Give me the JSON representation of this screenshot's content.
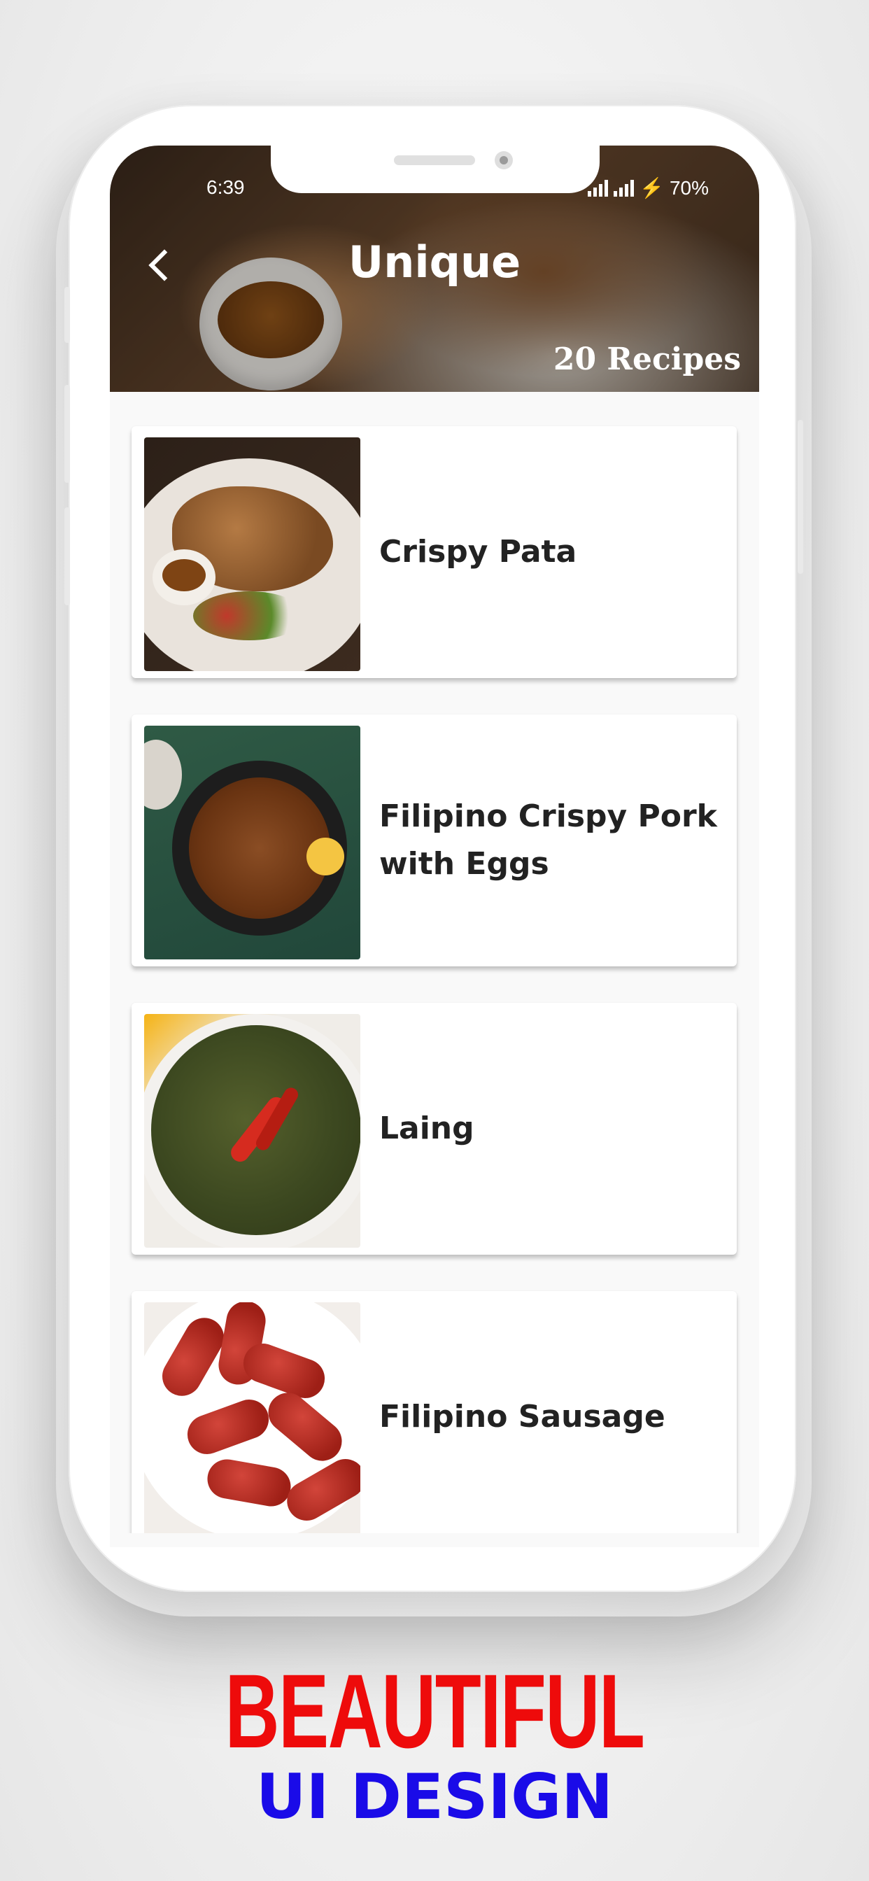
{
  "status_bar": {
    "time": "6:39",
    "battery": "70%"
  },
  "header": {
    "title": "Unique",
    "recipe_count": "20 Recipes"
  },
  "recipes": [
    {
      "title": "Crispy Pata"
    },
    {
      "title": "Filipino Crispy Pork with Eggs"
    },
    {
      "title": "Laing"
    },
    {
      "title": "Filipino Sausage"
    }
  ],
  "promo": {
    "headline": "BEAUTIFUL",
    "subheadline": "UI DESIGN"
  },
  "colors": {
    "headline": "#ee0b0b",
    "subheadline": "#1a0be8",
    "card_text": "#222222"
  }
}
